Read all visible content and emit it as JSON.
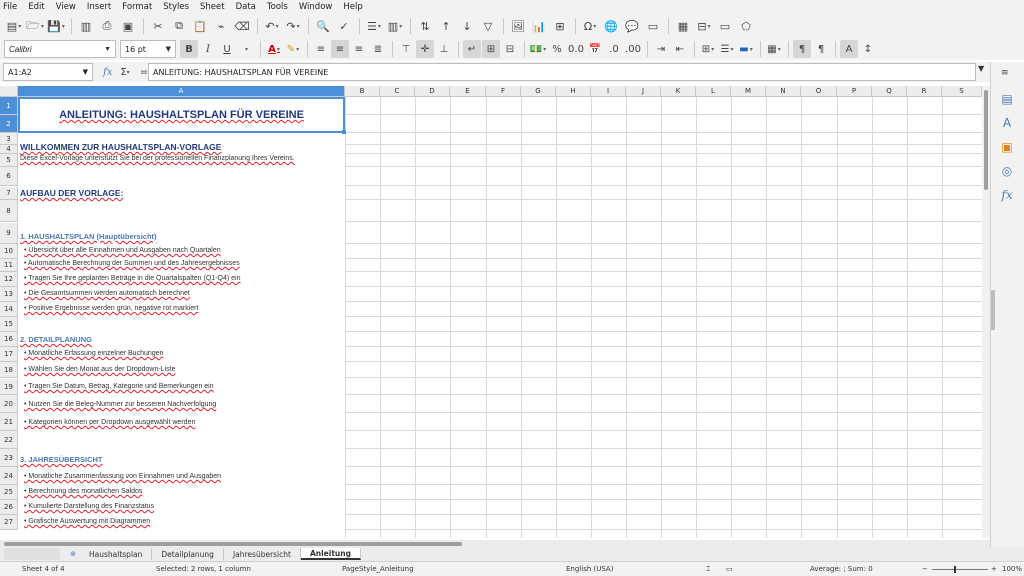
{
  "menu": [
    "File",
    "Edit",
    "View",
    "Insert",
    "Format",
    "Styles",
    "Sheet",
    "Data",
    "Tools",
    "Window",
    "Help"
  ],
  "toolbar2": {
    "font": "Calibri",
    "size": "16 pt",
    "bold": "B",
    "italic": "I",
    "underline": "U"
  },
  "formula": {
    "namebox": "A1:A2",
    "content": "ANLEITUNG: HAUSHALTSPLAN FÜR VEREINE",
    "fx": "fx",
    "sum": "Σ",
    "eq": "="
  },
  "columns": [
    "A",
    "B",
    "C",
    "D",
    "E",
    "F",
    "G",
    "H",
    "I",
    "J",
    "K",
    "L",
    "M",
    "N",
    "O",
    "P",
    "Q",
    "R",
    "S"
  ],
  "rows": [
    "1",
    "2",
    "3",
    "4",
    "5",
    "6",
    "7",
    "8",
    "9",
    "10",
    "11",
    "12",
    "13",
    "14",
    "15",
    "16",
    "17",
    "18",
    "19",
    "20",
    "21",
    "22",
    "23",
    "24",
    "25",
    "26",
    "27"
  ],
  "cells": {
    "title": "ANLEITUNG: HAUSHALTSPLAN FÜR VEREINE",
    "welcome": "WILLKOMMEN ZUR HAUSHALTSPLAN-VORLAGE",
    "intro": "Diese Excel-Vorlage unterstützt Sie bei der professionellen Finanzplanung Ihres Vereins.",
    "structure": "AUFBAU DER VORLAGE:",
    "sec1": "1. HAUSHALTSPLAN (Hauptübersicht)",
    "sec1_items": [
      "• Übersicht über alle Einnahmen und Ausgaben nach Quartalen",
      "• Automatische Berechnung der Summen und des Jahresergebnisses",
      "• Tragen Sie Ihre geplanten Beträge in die Quartalspalten (Q1-Q4) ein",
      "• Die Gesamtsummen werden automatisch berechnet",
      "• Positive Ergebnisse werden grün, negative rot markiert"
    ],
    "sec2": "2. DETAILPLANUNG",
    "sec2_items": [
      "• Monatliche Erfassung einzelner Buchungen",
      "• Wählen Sie den Monat aus der Dropdown-Liste",
      "• Tragen Sie Datum, Betrag, Kategorie und Bemerkungen ein",
      "• Nutzen Sie die Beleg-Nummer zur besseren Nachverfolgung",
      "• Kategorien können per Dropdown ausgewählt werden"
    ],
    "sec3": "3. JAHRESÜBERSICHT",
    "sec3_items": [
      "• Monatliche Zusammenfassung von Einnahmen und Ausgaben",
      "• Berechnung des monatlichen Saldos",
      "• Kumulierte Darstellung des Finanzstatus",
      "• Grafische Auswertung mit Diagrammen"
    ]
  },
  "tabs": {
    "items": [
      "Haushaltsplan",
      "Detailplanung",
      "Jahresübersicht",
      "Anleitung"
    ],
    "active": "Anleitung"
  },
  "status": {
    "sheet": "Sheet 4 of 4",
    "selection": "Selected: 2 rows, 1 column",
    "pagestyle": "PageStyle_Anleitung",
    "language": "English (USA)",
    "summary": "Average: ; Sum: 0",
    "zoom": "100%"
  },
  "colors": {
    "selection": "#4a8fd8",
    "heading": "#1f3b80",
    "subheading": "#4a7ab8"
  }
}
